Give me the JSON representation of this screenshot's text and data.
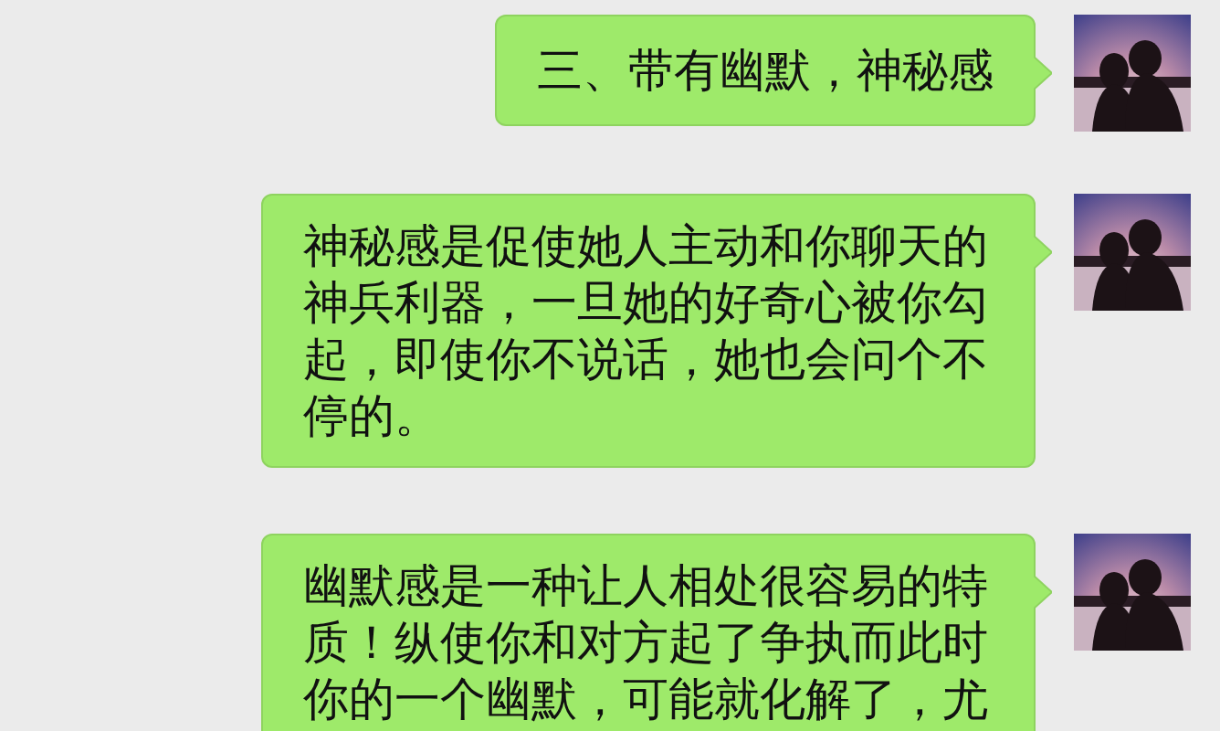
{
  "messages": [
    {
      "text": "三、带有幽默，神秘感"
    },
    {
      "text": "神秘感是促使她人主动和你聊天的神兵利器，一旦她的好奇心被你勾起，即使你不说话，她也会问个不停的。"
    },
    {
      "text": "幽默感是一种让人相处很容易的特质！纵使你和对方起了争执而此时你的一个幽默，可能就化解了，尤"
    }
  ]
}
